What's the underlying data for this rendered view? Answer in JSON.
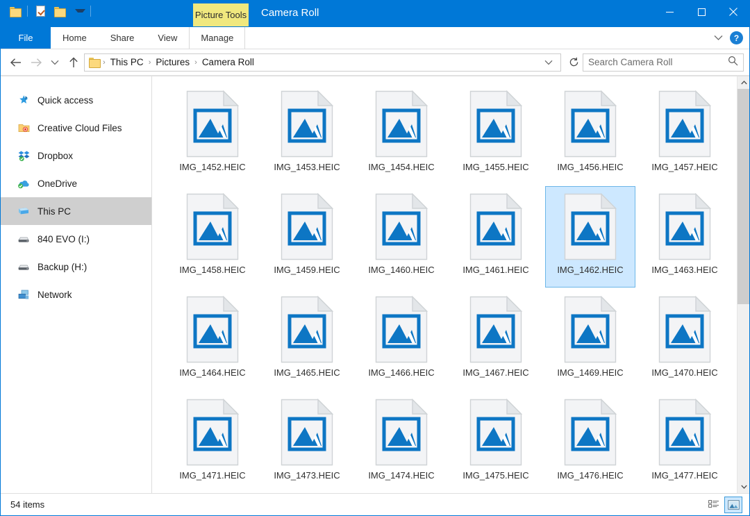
{
  "window": {
    "title": "Camera Roll",
    "accent_color": "#0078d7",
    "contextual_tab_color": "#f0e87e",
    "selection_color": "#cde8ff"
  },
  "quick_access_toolbar": {
    "items": [
      {
        "name": "folder-icon",
        "label": "Properties folder"
      },
      {
        "name": "properties-icon",
        "label": "Properties"
      },
      {
        "name": "new-folder-icon",
        "label": "New folder"
      },
      {
        "name": "chevron-down-icon",
        "label": "Customize Quick Access Toolbar"
      }
    ]
  },
  "contextual_header": {
    "label": "Picture Tools"
  },
  "window_controls": {
    "minimize": "Minimize",
    "maximize": "Maximize",
    "close": "Close"
  },
  "ribbon": {
    "file_tab": "File",
    "tabs": [
      {
        "label": "Home",
        "contextual": false
      },
      {
        "label": "Share",
        "contextual": false
      },
      {
        "label": "View",
        "contextual": false
      },
      {
        "label": "Manage",
        "contextual": true
      }
    ],
    "expand_label": "Expand the Ribbon",
    "help_label": "?"
  },
  "navigation": {
    "back": "Back",
    "forward": "Forward",
    "recent": "Recent locations",
    "up": "Up to Pictures"
  },
  "address_bar": {
    "crumbs": [
      "This PC",
      "Pictures",
      "Camera Roll"
    ],
    "separator": "›",
    "dropdown_label": "Previous locations",
    "refresh_label": "Refresh Camera Roll"
  },
  "search": {
    "placeholder": "Search Camera Roll",
    "value": "",
    "icon": "search-icon"
  },
  "sidebar": {
    "items": [
      {
        "label": "Quick access",
        "icon": "star-pin-icon",
        "selected": false
      },
      {
        "label": "Creative Cloud Files",
        "icon": "creative-cloud-folder-icon",
        "selected": false
      },
      {
        "label": "Dropbox",
        "icon": "dropbox-icon",
        "selected": false
      },
      {
        "label": "OneDrive",
        "icon": "onedrive-cloud-icon",
        "selected": false
      },
      {
        "label": "This PC",
        "icon": "this-pc-icon",
        "selected": true
      },
      {
        "label": "840 EVO (I:)",
        "icon": "drive-icon",
        "selected": false
      },
      {
        "label": "Backup (H:)",
        "icon": "drive-icon",
        "selected": false
      },
      {
        "label": "Network",
        "icon": "network-icon",
        "selected": false
      }
    ]
  },
  "files": [
    {
      "name": "IMG_1452.HEIC",
      "selected": false
    },
    {
      "name": "IMG_1453.HEIC",
      "selected": false
    },
    {
      "name": "IMG_1454.HEIC",
      "selected": false
    },
    {
      "name": "IMG_1455.HEIC",
      "selected": false
    },
    {
      "name": "IMG_1456.HEIC",
      "selected": false
    },
    {
      "name": "IMG_1457.HEIC",
      "selected": false
    },
    {
      "name": "IMG_1458.HEIC",
      "selected": false
    },
    {
      "name": "IMG_1459.HEIC",
      "selected": false
    },
    {
      "name": "IMG_1460.HEIC",
      "selected": false
    },
    {
      "name": "IMG_1461.HEIC",
      "selected": false
    },
    {
      "name": "IMG_1462.HEIC",
      "selected": true
    },
    {
      "name": "IMG_1463.HEIC",
      "selected": false
    },
    {
      "name": "IMG_1464.HEIC",
      "selected": false
    },
    {
      "name": "IMG_1465.HEIC",
      "selected": false
    },
    {
      "name": "IMG_1466.HEIC",
      "selected": false
    },
    {
      "name": "IMG_1467.HEIC",
      "selected": false
    },
    {
      "name": "IMG_1469.HEIC",
      "selected": false
    },
    {
      "name": "IMG_1470.HEIC",
      "selected": false
    },
    {
      "name": "IMG_1471.HEIC",
      "selected": false
    },
    {
      "name": "IMG_1473.HEIC",
      "selected": false
    },
    {
      "name": "IMG_1474.HEIC",
      "selected": false
    },
    {
      "name": "IMG_1475.HEIC",
      "selected": false
    },
    {
      "name": "IMG_1476.HEIC",
      "selected": false
    },
    {
      "name": "IMG_1477.HEIC",
      "selected": false
    }
  ],
  "scrollbar": {
    "thumb_percent": 55
  },
  "status_bar": {
    "item_count_text": "54 items",
    "views": [
      {
        "name": "details-view-button",
        "label": "Details view",
        "active": false
      },
      {
        "name": "large-icons-view-button",
        "label": "Large icons view",
        "active": true
      }
    ]
  }
}
